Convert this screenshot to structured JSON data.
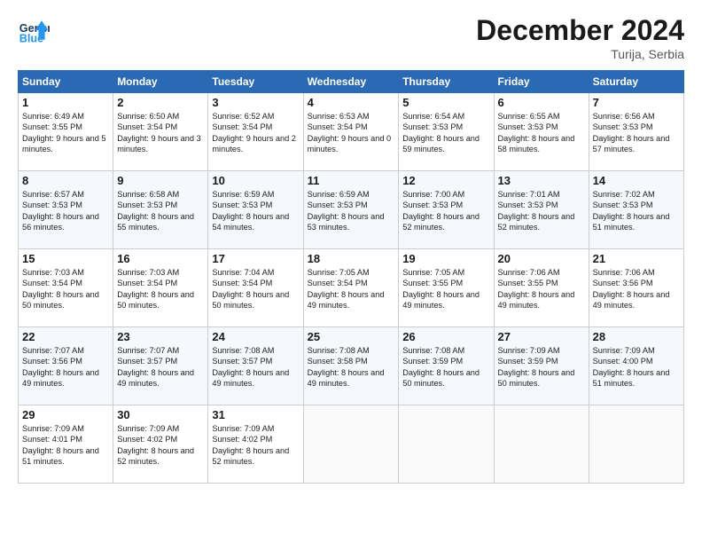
{
  "header": {
    "logo_line1": "General",
    "logo_line2": "Blue",
    "month": "December 2024",
    "location": "Turija, Serbia"
  },
  "weekdays": [
    "Sunday",
    "Monday",
    "Tuesday",
    "Wednesday",
    "Thursday",
    "Friday",
    "Saturday"
  ],
  "weeks": [
    [
      {
        "day": 1,
        "sunrise": "6:49 AM",
        "sunset": "3:55 PM",
        "daylight": "9 hours and 5 minutes."
      },
      {
        "day": 2,
        "sunrise": "6:50 AM",
        "sunset": "3:54 PM",
        "daylight": "9 hours and 3 minutes."
      },
      {
        "day": 3,
        "sunrise": "6:52 AM",
        "sunset": "3:54 PM",
        "daylight": "9 hours and 2 minutes."
      },
      {
        "day": 4,
        "sunrise": "6:53 AM",
        "sunset": "3:54 PM",
        "daylight": "9 hours and 0 minutes."
      },
      {
        "day": 5,
        "sunrise": "6:54 AM",
        "sunset": "3:53 PM",
        "daylight": "8 hours and 59 minutes."
      },
      {
        "day": 6,
        "sunrise": "6:55 AM",
        "sunset": "3:53 PM",
        "daylight": "8 hours and 58 minutes."
      },
      {
        "day": 7,
        "sunrise": "6:56 AM",
        "sunset": "3:53 PM",
        "daylight": "8 hours and 57 minutes."
      }
    ],
    [
      {
        "day": 8,
        "sunrise": "6:57 AM",
        "sunset": "3:53 PM",
        "daylight": "8 hours and 56 minutes."
      },
      {
        "day": 9,
        "sunrise": "6:58 AM",
        "sunset": "3:53 PM",
        "daylight": "8 hours and 55 minutes."
      },
      {
        "day": 10,
        "sunrise": "6:59 AM",
        "sunset": "3:53 PM",
        "daylight": "8 hours and 54 minutes."
      },
      {
        "day": 11,
        "sunrise": "6:59 AM",
        "sunset": "3:53 PM",
        "daylight": "8 hours and 53 minutes."
      },
      {
        "day": 12,
        "sunrise": "7:00 AM",
        "sunset": "3:53 PM",
        "daylight": "8 hours and 52 minutes."
      },
      {
        "day": 13,
        "sunrise": "7:01 AM",
        "sunset": "3:53 PM",
        "daylight": "8 hours and 52 minutes."
      },
      {
        "day": 14,
        "sunrise": "7:02 AM",
        "sunset": "3:53 PM",
        "daylight": "8 hours and 51 minutes."
      }
    ],
    [
      {
        "day": 15,
        "sunrise": "7:03 AM",
        "sunset": "3:54 PM",
        "daylight": "8 hours and 50 minutes."
      },
      {
        "day": 16,
        "sunrise": "7:03 AM",
        "sunset": "3:54 PM",
        "daylight": "8 hours and 50 minutes."
      },
      {
        "day": 17,
        "sunrise": "7:04 AM",
        "sunset": "3:54 PM",
        "daylight": "8 hours and 50 minutes."
      },
      {
        "day": 18,
        "sunrise": "7:05 AM",
        "sunset": "3:54 PM",
        "daylight": "8 hours and 49 minutes."
      },
      {
        "day": 19,
        "sunrise": "7:05 AM",
        "sunset": "3:55 PM",
        "daylight": "8 hours and 49 minutes."
      },
      {
        "day": 20,
        "sunrise": "7:06 AM",
        "sunset": "3:55 PM",
        "daylight": "8 hours and 49 minutes."
      },
      {
        "day": 21,
        "sunrise": "7:06 AM",
        "sunset": "3:56 PM",
        "daylight": "8 hours and 49 minutes."
      }
    ],
    [
      {
        "day": 22,
        "sunrise": "7:07 AM",
        "sunset": "3:56 PM",
        "daylight": "8 hours and 49 minutes."
      },
      {
        "day": 23,
        "sunrise": "7:07 AM",
        "sunset": "3:57 PM",
        "daylight": "8 hours and 49 minutes."
      },
      {
        "day": 24,
        "sunrise": "7:08 AM",
        "sunset": "3:57 PM",
        "daylight": "8 hours and 49 minutes."
      },
      {
        "day": 25,
        "sunrise": "7:08 AM",
        "sunset": "3:58 PM",
        "daylight": "8 hours and 49 minutes."
      },
      {
        "day": 26,
        "sunrise": "7:08 AM",
        "sunset": "3:59 PM",
        "daylight": "8 hours and 50 minutes."
      },
      {
        "day": 27,
        "sunrise": "7:09 AM",
        "sunset": "3:59 PM",
        "daylight": "8 hours and 50 minutes."
      },
      {
        "day": 28,
        "sunrise": "7:09 AM",
        "sunset": "4:00 PM",
        "daylight": "8 hours and 51 minutes."
      }
    ],
    [
      {
        "day": 29,
        "sunrise": "7:09 AM",
        "sunset": "4:01 PM",
        "daylight": "8 hours and 51 minutes."
      },
      {
        "day": 30,
        "sunrise": "7:09 AM",
        "sunset": "4:02 PM",
        "daylight": "8 hours and 52 minutes."
      },
      {
        "day": 31,
        "sunrise": "7:09 AM",
        "sunset": "4:02 PM",
        "daylight": "8 hours and 52 minutes."
      },
      null,
      null,
      null,
      null
    ]
  ]
}
